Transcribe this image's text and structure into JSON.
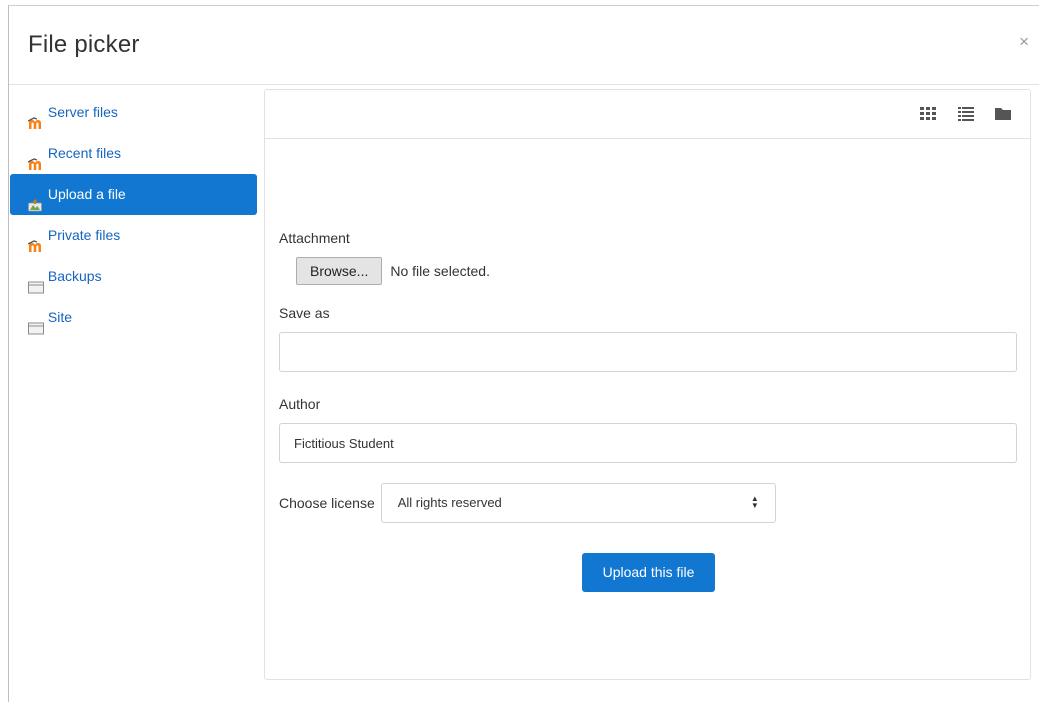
{
  "dialog": {
    "title": "File picker",
    "close_glyph": "×"
  },
  "sidebar": {
    "items": [
      {
        "label": "Server files",
        "icon": "moodle-icon",
        "active": false
      },
      {
        "label": "Recent files",
        "icon": "moodle-icon",
        "active": false
      },
      {
        "label": "Upload a file",
        "icon": "upload-icon",
        "active": true
      },
      {
        "label": "Private files",
        "icon": "moodle-icon",
        "active": false
      },
      {
        "label": "Backups",
        "icon": "folder-box-icon",
        "active": false
      },
      {
        "label": "Site",
        "icon": "folder-box-icon",
        "active": false
      }
    ]
  },
  "toolbar": {
    "views": [
      "grid-view-icon",
      "list-view-icon",
      "folder-view-icon"
    ]
  },
  "form": {
    "attachment_label": "Attachment",
    "browse_label": "Browse...",
    "no_file_text": "No file selected.",
    "save_as_label": "Save as",
    "save_as_value": "",
    "author_label": "Author",
    "author_value": "Fictitious Student",
    "license_label": "Choose license",
    "license_value": "All rights reserved",
    "upload_label": "Upload this file"
  },
  "colors": {
    "accent": "#1177d1",
    "link": "#1565c0",
    "moodle_orange": "#f98012"
  }
}
